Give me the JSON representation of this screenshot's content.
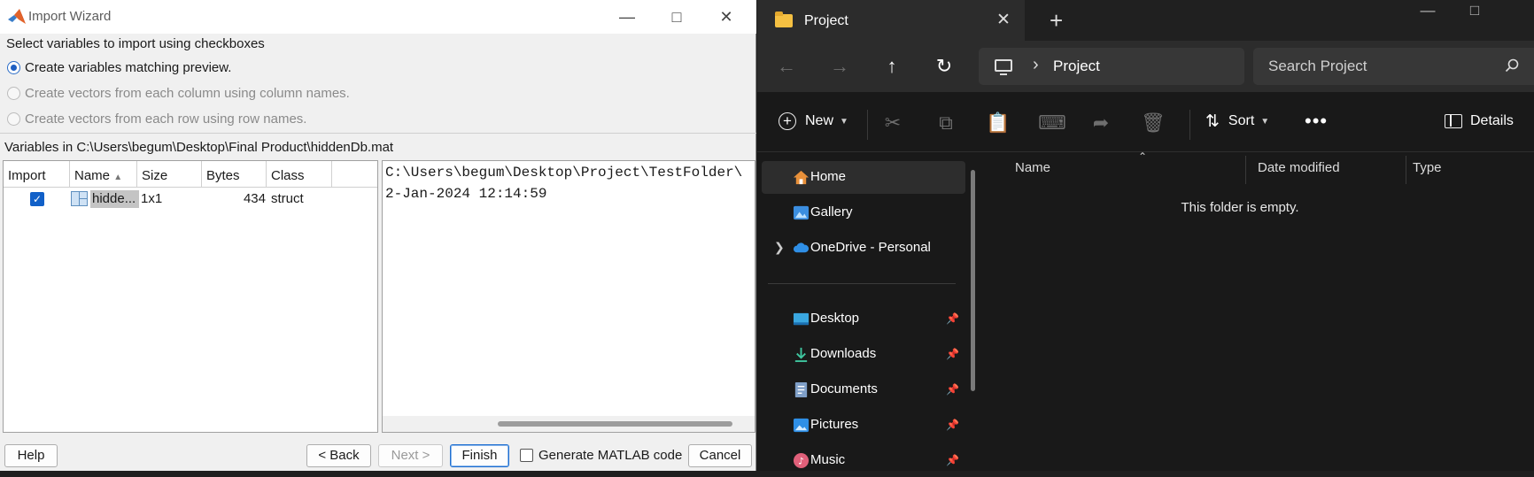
{
  "wizard": {
    "title": "Import Wizard",
    "instruction": "Select variables to import using checkboxes",
    "options": [
      {
        "label": "Create variables matching preview.",
        "selected": true,
        "enabled": true
      },
      {
        "label": "Create vectors from each column using column names.",
        "selected": false,
        "enabled": false
      },
      {
        "label": "Create vectors from each row using row names.",
        "selected": false,
        "enabled": false
      }
    ],
    "variables_label": "Variables in C:\\Users\\begum\\Desktop\\Final Product\\hiddenDb.mat",
    "table": {
      "headers": [
        "Import",
        "Name",
        "Size",
        "Bytes",
        "Class"
      ],
      "rows": [
        {
          "checked": true,
          "name": "hidde...",
          "size": "1x1",
          "bytes": "434",
          "class": "struct"
        }
      ]
    },
    "preview": {
      "line1": "C:\\Users\\begum\\Desktop\\Project\\TestFolder\\",
      "line2": "2-Jan-2024 12:14:59"
    },
    "buttons": {
      "help": "Help",
      "back": "< Back",
      "next": "Next >",
      "finish": "Finish",
      "generate": "Generate MATLAB code",
      "cancel": "Cancel"
    }
  },
  "explorer": {
    "tab_title": "Project",
    "address": "Project",
    "search_placeholder": "Search Project",
    "commands": {
      "new": "New",
      "sort": "Sort",
      "details": "Details"
    },
    "sidebar": [
      {
        "label": "Home",
        "icon": "home-icon",
        "selected": true
      },
      {
        "label": "Gallery",
        "icon": "gallery-icon"
      },
      {
        "label": "OneDrive - Personal",
        "icon": "cloud-icon",
        "expandable": true
      },
      {
        "label": "Desktop",
        "icon": "desktop-icon",
        "pinned": true
      },
      {
        "label": "Downloads",
        "icon": "download-icon",
        "pinned": true
      },
      {
        "label": "Documents",
        "icon": "documents-icon",
        "pinned": true
      },
      {
        "label": "Pictures",
        "icon": "pictures-icon",
        "pinned": true
      },
      {
        "label": "Music",
        "icon": "music-icon",
        "pinned": true
      }
    ],
    "columns": [
      "Name",
      "Date modified",
      "Type"
    ],
    "empty_message": "This folder is empty."
  }
}
